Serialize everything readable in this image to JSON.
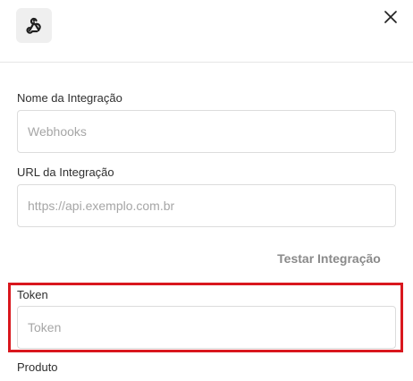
{
  "header": {
    "app_icon": "webhook-icon",
    "close_icon": "close-icon"
  },
  "form": {
    "name": {
      "label": "Nome da Integração",
      "placeholder": "Webhooks",
      "value": ""
    },
    "url": {
      "label": "URL da Integração",
      "placeholder": "https://api.exemplo.com.br",
      "value": ""
    },
    "test_button_label": "Testar Integração",
    "token": {
      "label": "Token",
      "placeholder": "Token",
      "value": ""
    },
    "product": {
      "label": "Produto"
    }
  },
  "colors": {
    "highlight": "#d9171e",
    "test_button_text": "#8a8a8a",
    "icon_background": "#efefef"
  }
}
